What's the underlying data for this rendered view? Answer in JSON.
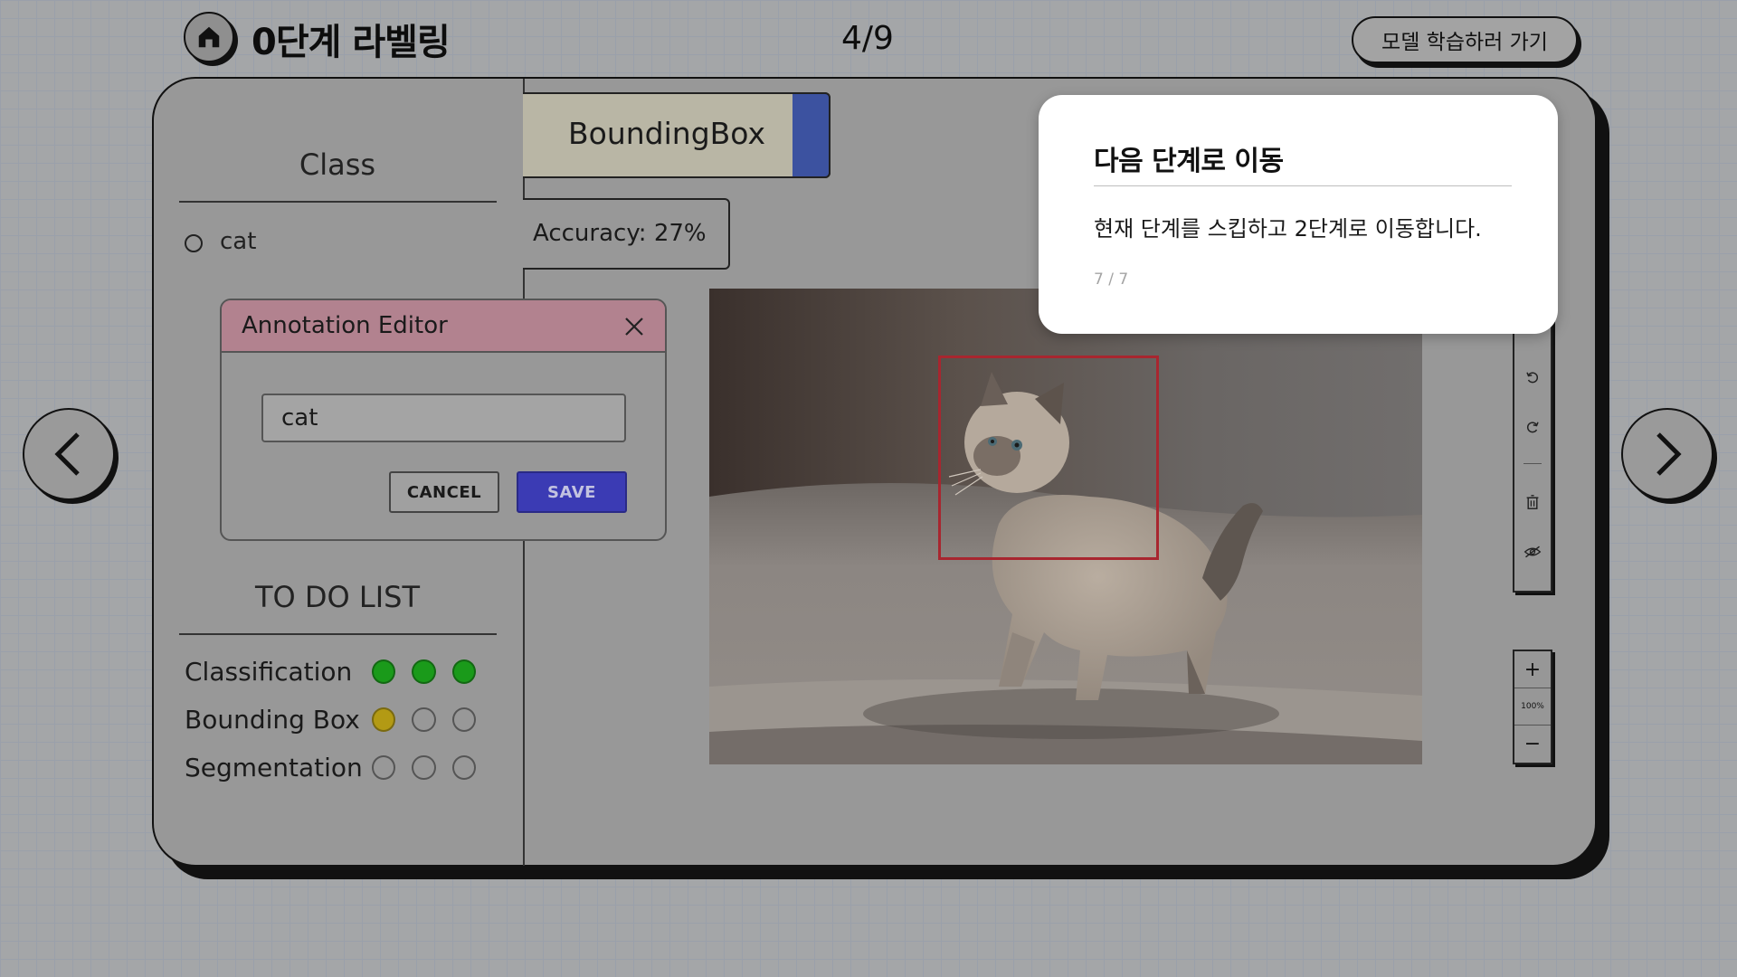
{
  "header": {
    "stage_title": "0단계 라벨링",
    "page_counter": "4/9",
    "train_button_label": "모델 학습하러 가기"
  },
  "class_panel": {
    "title": "Class",
    "classes": [
      {
        "label": "cat",
        "selected": false
      }
    ]
  },
  "tools": {
    "active_tool_label": "BoundingBox",
    "accuracy_text": "Accuracy: 27%"
  },
  "annotation": {
    "label": "cat",
    "box_color": "#c0282f"
  },
  "editor": {
    "title": "Annotation Editor",
    "input_value": "cat",
    "cancel_label": "CANCEL",
    "save_label": "SAVE"
  },
  "todo": {
    "title": "TO DO LIST",
    "items": [
      {
        "label": "Classification",
        "status": [
          "done",
          "done",
          "done"
        ]
      },
      {
        "label": "Bounding Box",
        "status": [
          "in-progress",
          "empty",
          "empty"
        ]
      },
      {
        "label": "Segmentation",
        "status": [
          "empty",
          "empty",
          "empty"
        ]
      }
    ]
  },
  "toolbar": {
    "icons": [
      "undo-icon",
      "redo-icon",
      "delete-icon",
      "hide-icon"
    ],
    "zoom_level": "100%"
  },
  "tour": {
    "title": "다음 단계로 이동",
    "body": "현재 단계를 스킵하고 2단계로 이동합니다.",
    "step": "7 / 7"
  },
  "colors": {
    "done": "#1a9a1a",
    "in_progress": "#b39a14",
    "save_button": "#3b3bb4",
    "editor_header": "#b2828f",
    "active_tool_accent": "#3c52a0"
  }
}
